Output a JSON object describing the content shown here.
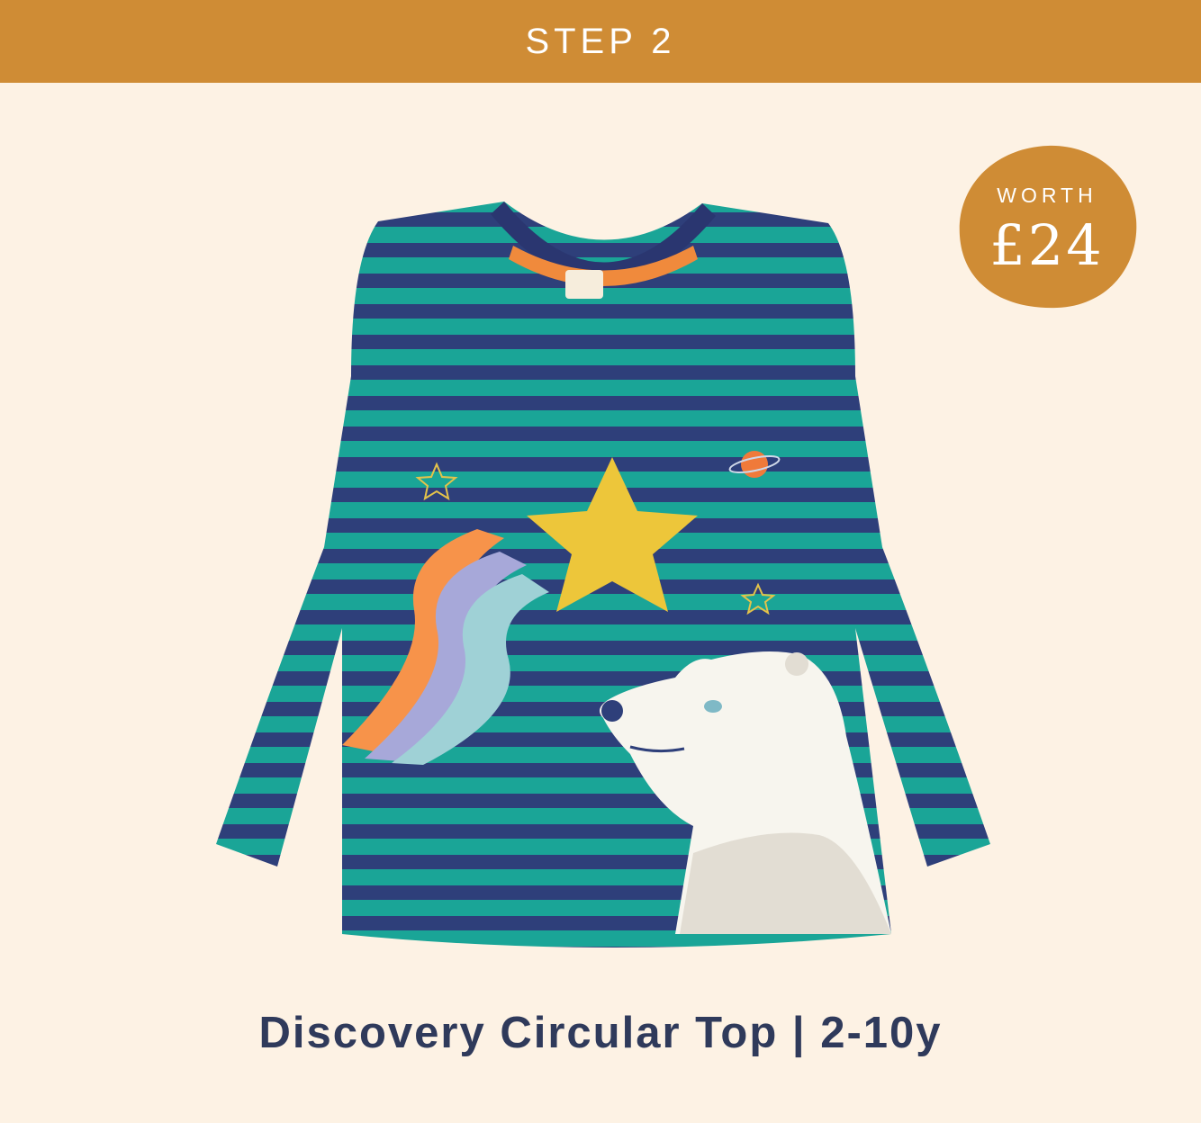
{
  "banner": {
    "label": "STEP 2"
  },
  "badge": {
    "label": "WORTH",
    "price": "£24"
  },
  "product": {
    "title": "Discovery Circular Top | 2-10y"
  },
  "colors": {
    "banner": "#cf8c35",
    "background": "#fdf2e4",
    "badge": "#cf8c35",
    "caption": "#2f3a5b",
    "stripe_teal": "#1aa597",
    "stripe_navy": "#2e3f7a"
  }
}
